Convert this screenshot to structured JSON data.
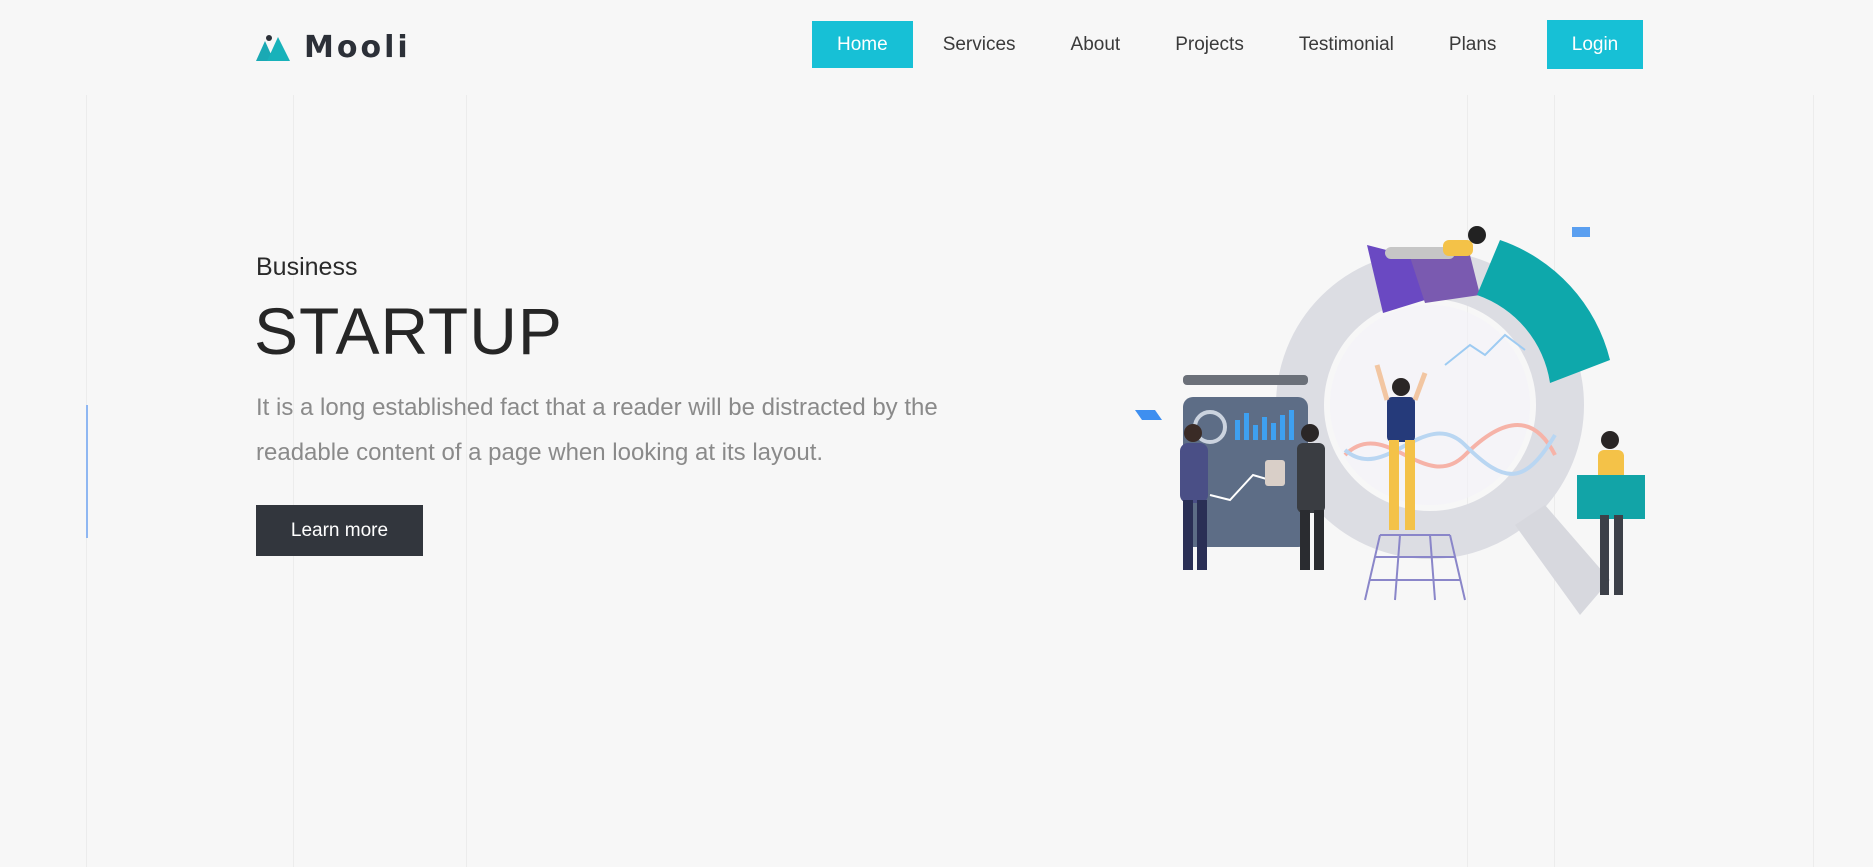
{
  "brand": {
    "name": "Mooli",
    "logo_icon": "mountain-logo-icon",
    "accent": "#17c0d6"
  },
  "nav": {
    "items": [
      {
        "label": "Home",
        "active": true
      },
      {
        "label": "Services",
        "active": false
      },
      {
        "label": "About",
        "active": false
      },
      {
        "label": "Projects",
        "active": false
      },
      {
        "label": "Testimonial",
        "active": false
      },
      {
        "label": "Plans",
        "active": false
      }
    ],
    "login_label": "Login"
  },
  "hero": {
    "subtitle": "Business",
    "title": "STARTUP",
    "description": "It is a long established fact that a reader will be distracted by the readable content of a page when looking at its layout.",
    "cta_label": "Learn more",
    "cta_color": "#32363d"
  },
  "illustration": {
    "icon": "business-team-analytics-illustration"
  }
}
